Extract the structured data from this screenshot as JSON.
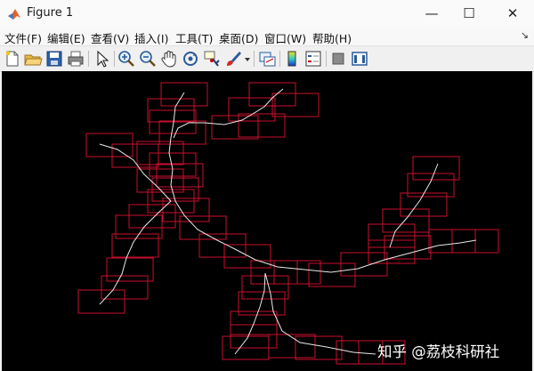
{
  "window": {
    "title": "Figure 1",
    "minimize": "—",
    "maximize": "☐",
    "close": "✕"
  },
  "menu": [
    "文件(F)",
    "编辑(E)",
    "查看(V)",
    "插入(I)",
    "工具(T)",
    "桌面(D)",
    "窗口(W)",
    "帮助(H)"
  ],
  "toolbar_icons": [
    "new-figure-icon",
    "open-file-icon",
    "save-icon",
    "print-icon",
    "pointer-icon",
    "zoom-in-icon",
    "zoom-out-icon",
    "pan-icon",
    "rotate-3d-icon",
    "data-cursor-icon",
    "brush-icon",
    "brush-dropdown-icon",
    "link-plot-icon",
    "colorbar-icon",
    "legend-icon",
    "hide-plot-tools-icon",
    "show-plot-tools-icon"
  ],
  "colors": {
    "background": "#000000",
    "path": "#e8e8e8",
    "boxes": "#c8102e"
  },
  "watermark": "知乎 @荔枝科研社"
}
